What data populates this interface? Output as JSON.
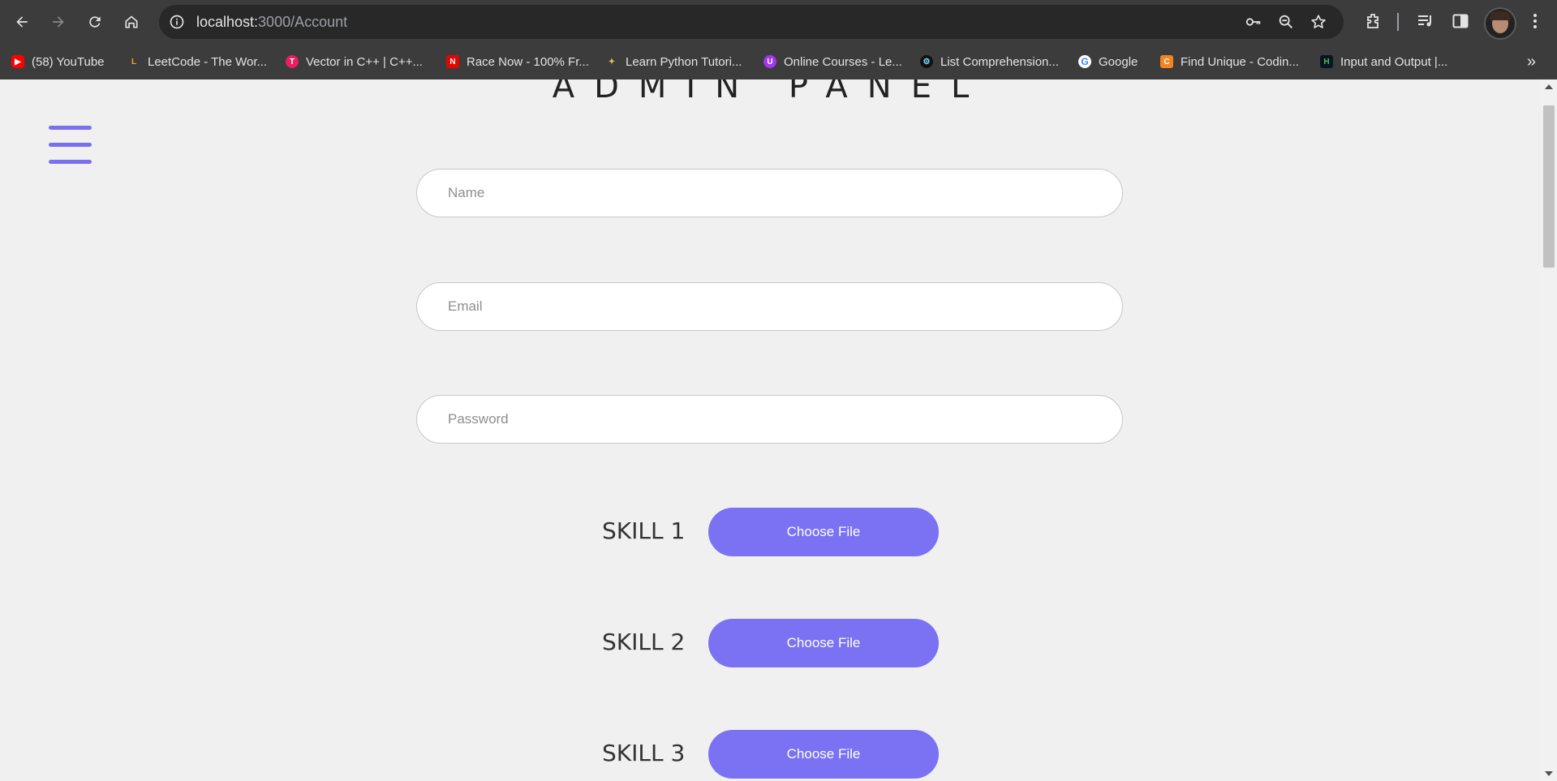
{
  "browser": {
    "url_host": "localhost:",
    "url_path": "3000/Account",
    "bookmarks": [
      {
        "label": "(58) YouTube",
        "icon": "youtube-icon",
        "color": "#ff0000",
        "glyph": "▶"
      },
      {
        "label": "LeetCode - The Wor...",
        "icon": "leetcode-icon",
        "color": "#3c3c3c",
        "glyph": "L"
      },
      {
        "label": "Vector in C++ | C++...",
        "icon": "vector-site-icon",
        "color": "#e91e63",
        "glyph": "T"
      },
      {
        "label": "Race Now - 100% Fr...",
        "icon": "race-now-icon",
        "color": "#e10600",
        "glyph": "N"
      },
      {
        "label": "Learn Python Tutori...",
        "icon": "python-tutorial-icon",
        "color": "#3c3c3c",
        "glyph": "🐍"
      },
      {
        "label": "Online Courses - Le...",
        "icon": "udemy-icon",
        "color": "#a435f0",
        "glyph": "U"
      },
      {
        "label": "List Comprehension...",
        "icon": "list-comprehension-icon",
        "color": "#1e1e1e",
        "glyph": "⚙"
      },
      {
        "label": "Google",
        "icon": "google-icon",
        "color": "#ffffff",
        "glyph": "G"
      },
      {
        "label": "Find Unique - Codin...",
        "icon": "coding-ninjas-icon",
        "color": "#f4841f",
        "glyph": "C"
      },
      {
        "label": "Input and Output |...",
        "icon": "hackerrank-icon",
        "color": "#0e141e",
        "glyph": "H"
      }
    ]
  },
  "page": {
    "title": "ADMIN PANEL",
    "fields": {
      "name_placeholder": "Name",
      "email_placeholder": "Email",
      "password_placeholder": "Password"
    },
    "skills": [
      {
        "label": "SKILL 1",
        "button": "Choose File"
      },
      {
        "label": "SKILL 2",
        "button": "Choose File"
      },
      {
        "label": "SKILL 3",
        "button": "Choose File"
      }
    ]
  },
  "colors": {
    "accent": "#7a72f2",
    "hamburger": "#7b6ff0",
    "page_bg": "#f0f0f0",
    "chrome_bg": "#3c3c3c"
  }
}
